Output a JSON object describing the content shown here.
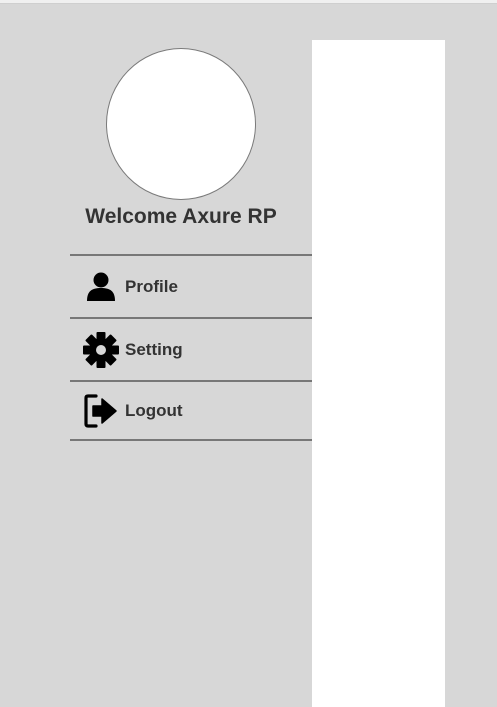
{
  "user": {
    "welcome_text": "Welcome Axure RP"
  },
  "menu": {
    "items": [
      {
        "label": "Profile",
        "icon": "user-icon"
      },
      {
        "label": "Setting",
        "icon": "gear-icon"
      },
      {
        "label": "Logout",
        "icon": "sign-out-icon"
      }
    ]
  },
  "colors": {
    "background": "#d7d7d7",
    "panel": "#ffffff",
    "text": "#333333",
    "divider": "#777777",
    "icon": "#000000"
  }
}
